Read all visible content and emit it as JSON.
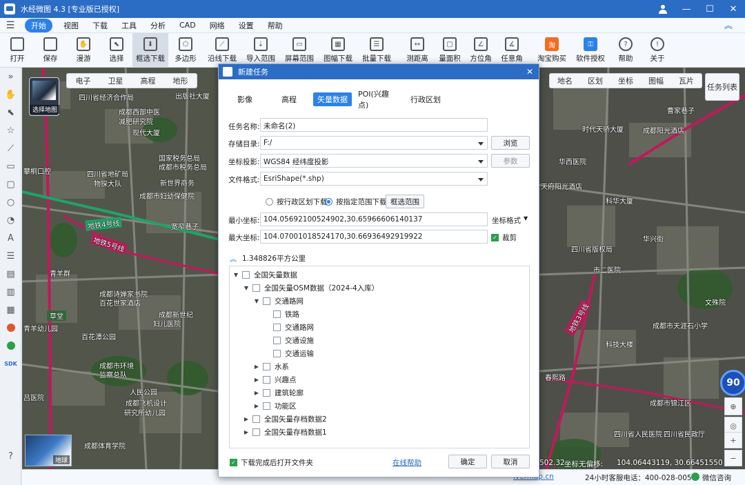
{
  "app": {
    "title": "水经微图 4.3 [专业版已授权]",
    "min_label": "—",
    "max_label": "☐",
    "close_label": "✕"
  },
  "menu": [
    "开始",
    "视图",
    "下载",
    "工具",
    "分析",
    "CAD",
    "网络",
    "设置",
    "帮助"
  ],
  "toolbar": [
    {
      "label": "打开",
      "icon": "folder-icon",
      "glyph": ""
    },
    {
      "label": "保存",
      "icon": "save-icon",
      "glyph": ""
    },
    {
      "label": "漫游",
      "icon": "hand-icon",
      "glyph": "✋"
    },
    {
      "label": "选择",
      "icon": "pointer-icon",
      "glyph": "⬉"
    },
    {
      "label": "框选下载",
      "icon": "box-download-icon",
      "glyph": "⬇"
    },
    {
      "label": "多边形",
      "icon": "polygon-icon",
      "glyph": "⬠"
    },
    {
      "label": "沿线下载",
      "icon": "polyline-download-icon",
      "glyph": "⟋"
    },
    {
      "label": "导入范围",
      "icon": "import-range-icon",
      "glyph": "⇣"
    },
    {
      "label": "屏幕范围",
      "icon": "screen-range-icon",
      "glyph": "▭"
    },
    {
      "label": "图幅下载",
      "icon": "sheet-download-icon",
      "glyph": "▦"
    },
    {
      "label": "批量下载",
      "icon": "batch-download-icon",
      "glyph": "☰"
    },
    {
      "label": "测距离",
      "icon": "measure-distance-icon",
      "glyph": "↔"
    },
    {
      "label": "量面积",
      "icon": "measure-area-icon",
      "glyph": "▢"
    },
    {
      "label": "方位角",
      "icon": "azimuth-icon",
      "glyph": "∠"
    },
    {
      "label": "任意角",
      "icon": "any-angle-icon",
      "glyph": "∡"
    },
    {
      "label": "淘宝购买",
      "icon": "taobao-icon",
      "glyph": "淘"
    },
    {
      "label": "软件授权",
      "icon": "license-icon",
      "glyph": "⚿"
    },
    {
      "label": "帮助",
      "icon": "help-icon",
      "glyph": "?"
    },
    {
      "label": "关于",
      "icon": "about-icon",
      "glyph": "!"
    }
  ],
  "map": {
    "types": [
      "电子",
      "卫星",
      "高程",
      "地形"
    ],
    "right_tabs": [
      "地名",
      "区划",
      "坐标",
      "图幅",
      "瓦片"
    ],
    "layer_button": "选择地图",
    "task_list": "任务列表",
    "earth_label": "地球",
    "zoom_badge": "90",
    "labels": [
      "四川省经济合作局",
      "出版社大厦",
      "成都西部中医",
      "减肥研究院",
      "现代大厦",
      "四川省地矿局",
      "物探大队",
      "国家税务总局",
      "成都市税务总局",
      "新世界商务",
      "成都市妇幼保健院",
      "攀桐口腔",
      "地铁4号线",
      "地铁5号线",
      "宽窄巷子",
      "青羊群",
      "成都诗婵家书院",
      "百花世家酒店",
      "成都新世纪",
      "妇儿医院",
      "百花潭公园",
      "成都市环境",
      "监察总队",
      "成都飞机设计",
      "研究所幼儿园",
      "成都体育学院",
      "华西医院",
      "成都阳光酒店",
      "四川省人民医院",
      "成都市天涯石小学",
      "科技大楼",
      "春熙路",
      "成都市锦江区",
      "四川省民政厅",
      "曹家巷子",
      "时代天骄大厦",
      "天府阳光酒店",
      "科华大厦",
      "四川省版权局",
      "市二医院",
      "华兴街",
      "文殊院",
      "地铁3号线",
      "草堂",
      "吕医院",
      "青羊幼儿园",
      "人民公园"
    ]
  },
  "dialog": {
    "title": "新建任务",
    "tabs": [
      "影像",
      "高程",
      "矢量数据",
      "POI(兴趣点)",
      "行政区划"
    ],
    "task_name_label": "任务名称:",
    "task_name": "未命名(2)",
    "save_dir_label": "存储目录:",
    "save_dir": "F:/",
    "browse": "浏览",
    "proj_label": "坐标投影:",
    "proj": "WGS84 经纬度投影",
    "params": "参数",
    "format_label": "文件格式:",
    "format": "EsriShape(*.shp)",
    "radio_admin": "按行政区划下载",
    "radio_range": "按指定范围下载",
    "select_range": "框选范围",
    "min_label": "最小坐标:",
    "min_value": "104.05692100524902,30.65966606140137",
    "max_label": "最大坐标:",
    "max_value": "104.07001018524170,30.66936492919922",
    "coord_format": "坐标格式",
    "clip": "裁剪",
    "area": "1.348826平方公里",
    "tree": [
      {
        "level": 0,
        "arrow": "▼",
        "label": "全国矢量数据"
      },
      {
        "level": 1,
        "arrow": "▼",
        "label": "全国矢量OSM数据（2024-4入库）"
      },
      {
        "level": 2,
        "arrow": "▼",
        "label": "交通路网"
      },
      {
        "level": 3,
        "arrow": "",
        "label": "铁路"
      },
      {
        "level": 3,
        "arrow": "",
        "label": "交通路网"
      },
      {
        "level": 3,
        "arrow": "",
        "label": "交通设施"
      },
      {
        "level": 3,
        "arrow": "",
        "label": "交通运输"
      },
      {
        "level": 2,
        "arrow": "▶",
        "label": "水系"
      },
      {
        "level": 2,
        "arrow": "▶",
        "label": "兴趣点"
      },
      {
        "level": 2,
        "arrow": "▶",
        "label": "建筑轮廓"
      },
      {
        "level": 2,
        "arrow": "▶",
        "label": "功能区"
      },
      {
        "level": 1,
        "arrow": "▶",
        "label": "全国矢量存档数据2"
      },
      {
        "level": 1,
        "arrow": "▶",
        "label": "全国矢量存档数据1"
      }
    ],
    "open_after": "下载完成后打开文件夹",
    "help_link": "在线帮助",
    "ok": "确定",
    "cancel": "取消"
  },
  "status": {
    "scale_partial": "502.32",
    "coord_label": "坐标无偏移:",
    "coord": "104.06443119, 30.66451550",
    "url_partial": "ivermap.cn",
    "hotline": "24小时客服电话：400-028-0050",
    "wechat": "微信咨询"
  },
  "colors": {
    "accent": "#2b82e8",
    "titlebar": "#2b6cc4",
    "metro_line": "#c2185b",
    "checked": "#2b82e8"
  }
}
